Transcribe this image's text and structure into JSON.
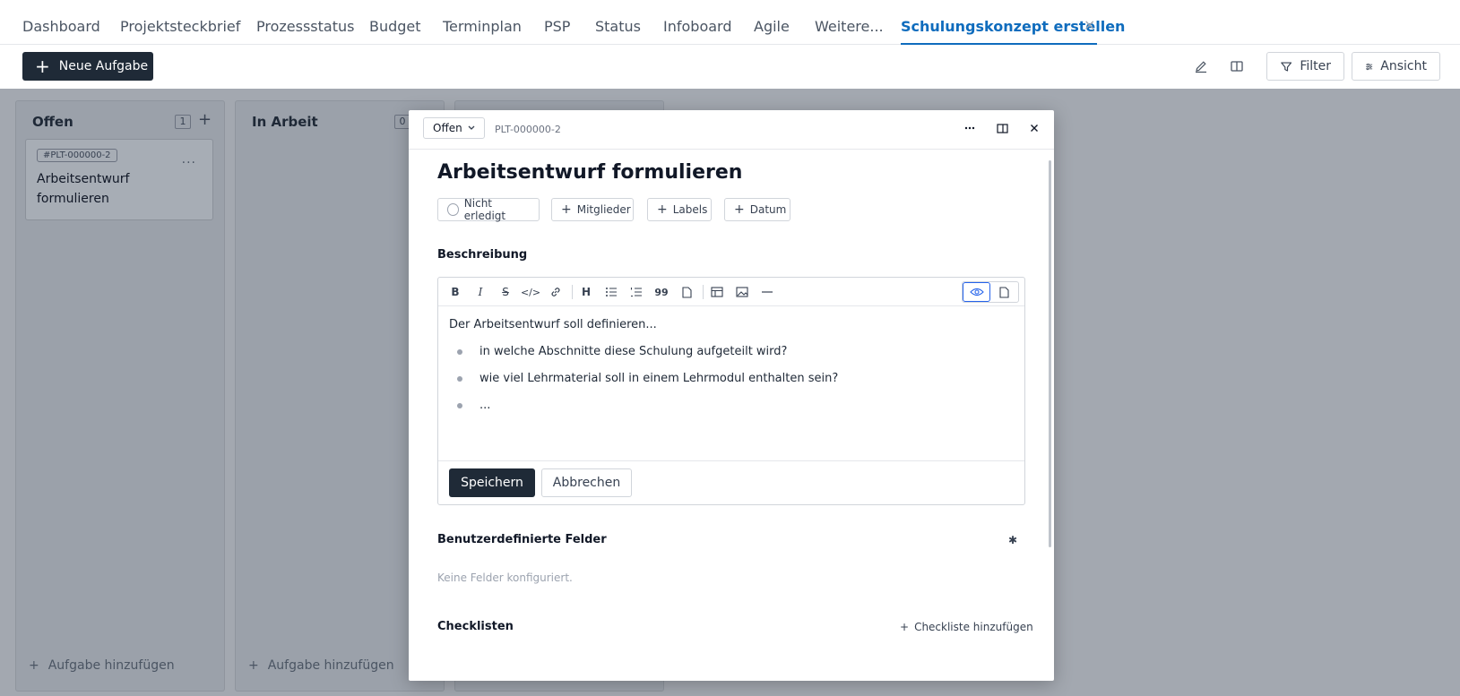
{
  "nav": {
    "tabs": [
      {
        "label": "Dashboard"
      },
      {
        "label": "Projektsteckbrief"
      },
      {
        "label": "Prozessstatus"
      },
      {
        "label": "Budget"
      },
      {
        "label": "Terminplan"
      },
      {
        "label": "PSP"
      },
      {
        "label": "Status"
      },
      {
        "label": "Infoboard"
      },
      {
        "label": "Agile"
      },
      {
        "label": "Weitere..."
      },
      {
        "label": "Schulungskonzept erstellen"
      }
    ],
    "close_icon": "×",
    "accent": "#0f6cbd"
  },
  "toolbar": {
    "new_task_label": "Neue Aufgabe",
    "filter_label": "Filter",
    "view_label": "Ansicht"
  },
  "board": {
    "columns": [
      {
        "title": "Offen",
        "count": "1",
        "add_label": "Aufgabe hinzufügen",
        "cards": [
          {
            "id": "#PLT-000000-2",
            "title": "Arbeitsentwurf formulieren",
            "menu": "..."
          }
        ]
      },
      {
        "title": "In Arbeit",
        "count": "0",
        "add_label": "Aufgabe hinzufügen",
        "cards": []
      }
    ]
  },
  "modal": {
    "status": "Offen",
    "task_id": "PLT-000000-2",
    "title": "Arbeitsentwurf formulieren",
    "chips": {
      "not_done": "Nicht erledigt",
      "members": "Mitglieder",
      "labels": "Labels",
      "date": "Datum"
    },
    "description_label": "Beschreibung",
    "editor": {
      "intro": "Der Arbeitsentwurf soll definieren...",
      "bullets": [
        "in welche Abschnitte diese Schulung aufgeteilt wird?",
        "wie viel Lehrmaterial soll in einem Lehrmodul enthalten sein?",
        "..."
      ],
      "save_label": "Speichern",
      "cancel_label": "Abbrechen"
    },
    "custom_fields_label": "Benutzerdefinierte Felder",
    "no_fields_text": "Keine Felder konfiguriert.",
    "checklists_label": "Checklisten",
    "add_checklist_label": "Checkliste hinzufügen"
  }
}
